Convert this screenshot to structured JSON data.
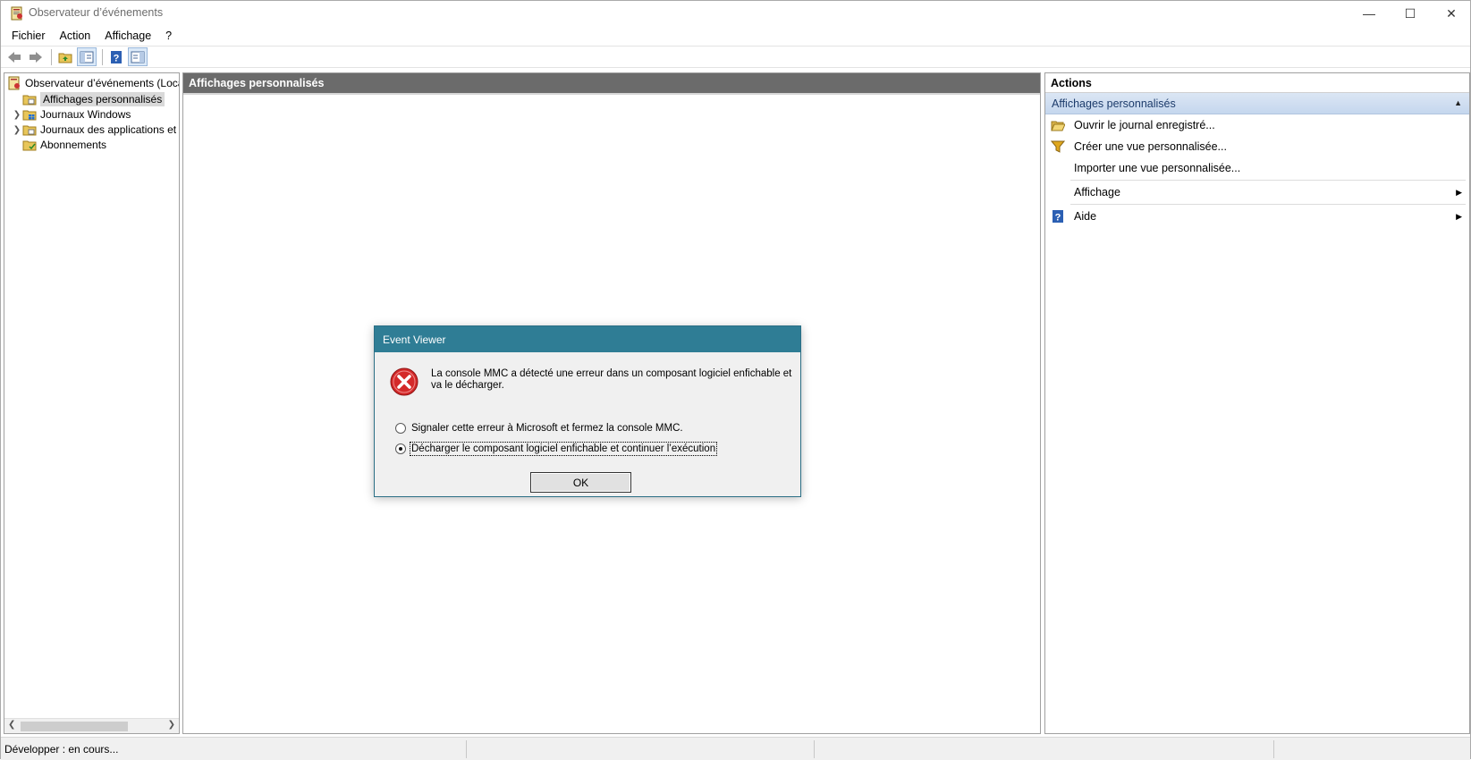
{
  "window": {
    "title": "Observateur d’événements",
    "minimize_glyph": "—",
    "maximize_glyph": "☐",
    "close_glyph": "✕"
  },
  "menu": {
    "items": [
      "Fichier",
      "Action",
      "Affichage",
      "?"
    ]
  },
  "toolbar": {
    "icons": [
      "back-arrow-icon",
      "forward-arrow-icon",
      "folder-up-icon",
      "show-hide-tree-icon",
      "help-icon",
      "show-hide-action-pane-icon"
    ]
  },
  "tree": {
    "root": "Observateur d’événements (Loca",
    "items": [
      {
        "label": "Affichages personnalisés",
        "selected": true,
        "expandable": false
      },
      {
        "label": "Journaux Windows",
        "selected": false,
        "expandable": true
      },
      {
        "label": "Journaux des applications et",
        "selected": false,
        "expandable": true
      },
      {
        "label": "Abonnements",
        "selected": false,
        "expandable": false
      }
    ]
  },
  "center": {
    "header": "Affichages personnalisés"
  },
  "actions": {
    "title": "Actions",
    "section": "Affichages personnalisés",
    "items": [
      {
        "label": "Ouvrir le journal enregistré...",
        "icon": "open-folder-icon"
      },
      {
        "label": "Créer une vue personnalisée...",
        "icon": "filter-icon"
      },
      {
        "label": "Importer une vue personnalisée...",
        "icon": ""
      },
      {
        "label": "Affichage",
        "icon": "",
        "submenu": true
      },
      {
        "label": "Aide",
        "icon": "help-icon",
        "submenu": true
      }
    ]
  },
  "status": {
    "text": "Développer :  en cours..."
  },
  "dialog": {
    "title": "Event Viewer",
    "message": "La console MMC a détecté une erreur dans un  composant logiciel enfichable et va le décharger.",
    "options": [
      {
        "label": "Signaler cette erreur à Microsoft et fermez la console MMC.",
        "checked": false
      },
      {
        "label": "Décharger le composant logiciel enfichable et continuer l’exécution",
        "checked": true
      }
    ],
    "ok_label": "OK"
  },
  "colors": {
    "dialog_title": "#2f7d95",
    "center_header": "#6b6b6b",
    "actions_section": "#c5d7ee"
  }
}
